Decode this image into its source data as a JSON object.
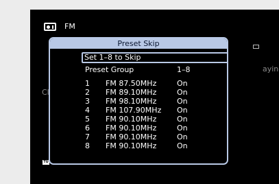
{
  "source": {
    "label": "FM",
    "icon": "tuner-icon",
    "side_fragment_left": "Cl",
    "side_fragment_right": "aying",
    "badge": "TU"
  },
  "dialog": {
    "title": "Preset Skip",
    "set_label": "Set 1–8 to Skip",
    "group_label": "Preset Group",
    "group_value": "1–8",
    "presets": [
      {
        "num": "1",
        "freq": "FM 87.50MHz",
        "status": "On"
      },
      {
        "num": "2",
        "freq": "FM 89.10MHz",
        "status": "On"
      },
      {
        "num": "3",
        "freq": "FM 98.10MHz",
        "status": "On"
      },
      {
        "num": "4",
        "freq": "FM 107.90MHz",
        "status": "On"
      },
      {
        "num": "5",
        "freq": "FM 90.10MHz",
        "status": "On"
      },
      {
        "num": "6",
        "freq": "FM 90.10MHz",
        "status": "On"
      },
      {
        "num": "7",
        "freq": "FM 90.10MHz",
        "status": "On"
      },
      {
        "num": "8",
        "freq": "FM 90.10MHz",
        "status": "On"
      }
    ]
  },
  "colors": {
    "screen_bg": "#000000",
    "accent": "#b9c9e6",
    "page_bg": "#ececec"
  }
}
